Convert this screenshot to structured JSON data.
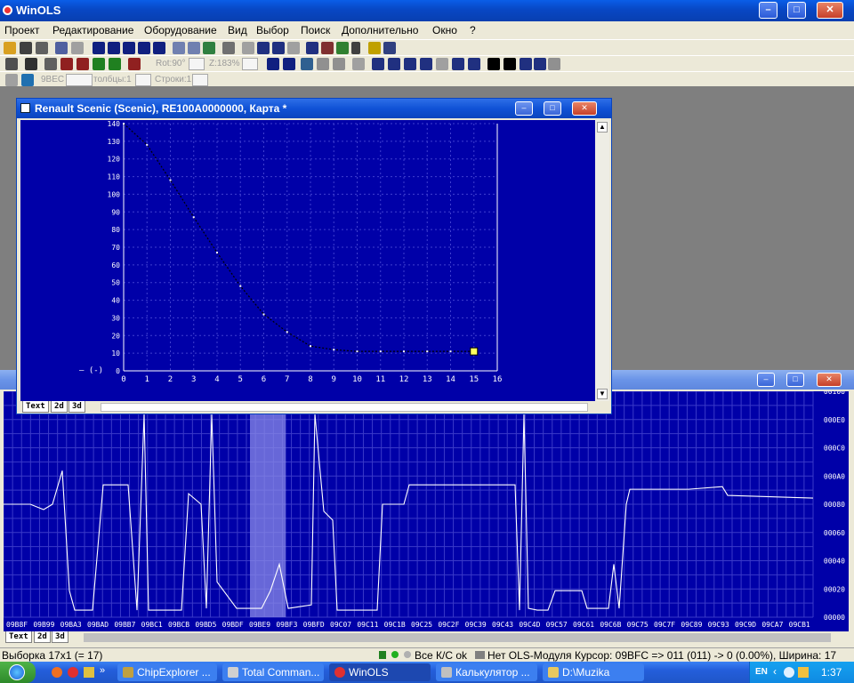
{
  "app": {
    "title": "WinOLS"
  },
  "menu": [
    "Проект",
    "Редактирование",
    "Оборудование",
    "Вид",
    "Выбор",
    "Поиск",
    "Дополнительно",
    "Окно",
    "?"
  ],
  "toolbar": {
    "rot_label": "Rot:90°",
    "zoom_label": "Z:183%",
    "base_label": "9BEC",
    "cols_label": "толбцы:1",
    "rows_label": "Строки:1"
  },
  "map_window": {
    "title": "Renault Scenic (Scenic), RE100A0000000, Карта *",
    "axis_unit_label": "– (-)",
    "tabs": [
      "Text",
      "2d",
      "3d"
    ]
  },
  "hex_window": {
    "tabs": [
      "Text",
      "2d",
      "3d"
    ]
  },
  "chart_data": [
    {
      "type": "line",
      "x": [
        0,
        1,
        2,
        3,
        4,
        5,
        6,
        7,
        8,
        9,
        10,
        11,
        12,
        13,
        14,
        15
      ],
      "values": [
        140,
        128,
        108,
        87,
        67,
        48,
        32,
        22,
        14,
        12,
        11,
        11,
        11,
        11,
        11,
        11
      ],
      "xlim": [
        0,
        16
      ],
      "ylim": [
        0,
        140
      ],
      "x_ticks": [
        "0",
        "1",
        "2",
        "3",
        "4",
        "5",
        "6",
        "7",
        "8",
        "9",
        "10",
        "11",
        "12",
        "13",
        "14",
        "15",
        "16"
      ],
      "y_ticks": [
        "0",
        "10",
        "20",
        "30",
        "40",
        "50",
        "60",
        "70",
        "80",
        "90",
        "100",
        "110",
        "120",
        "130",
        "140"
      ],
      "grid": true,
      "cursor_x": 15
    },
    {
      "type": "line",
      "x_ticks": [
        "09B8F",
        "09B99",
        "09BA3",
        "09BAD",
        "09BB7",
        "09BC1",
        "09BCB",
        "09BD5",
        "09BDF",
        "09BE9",
        "09BF3",
        "09BFD",
        "09C07",
        "09C11",
        "09C1B",
        "09C25",
        "09C2F",
        "09C39",
        "09C43",
        "09C4D",
        "09C57",
        "09C61",
        "09C6B",
        "09C75",
        "09C7F",
        "09C89",
        "09C93",
        "09C9D",
        "09CA7",
        "09CB1"
      ],
      "y_ticks": [
        "00000",
        "00020",
        "00040",
        "00060",
        "00080",
        "000A0",
        "000C0",
        "000E0",
        "00100"
      ],
      "ylim": [
        0,
        256
      ],
      "selection": [
        "09BE9",
        "09BF3"
      ],
      "grid": true
    }
  ],
  "status": {
    "selection": "Выборка 17x1 (= 17)",
    "checksum": "Все К/С ok",
    "ols_module": "Нет OLS-Модуля",
    "cursor": "Курсор: 09BFC => 011 (011) -> 0 (0.00%), Ширина: 17"
  },
  "taskbar": {
    "tasks": [
      "ChipExplorer ...",
      "Total Comman...",
      "WinOLS",
      "Калькулятор ...",
      "D:\\Muzika"
    ],
    "language": "EN",
    "clock": "1:37"
  }
}
